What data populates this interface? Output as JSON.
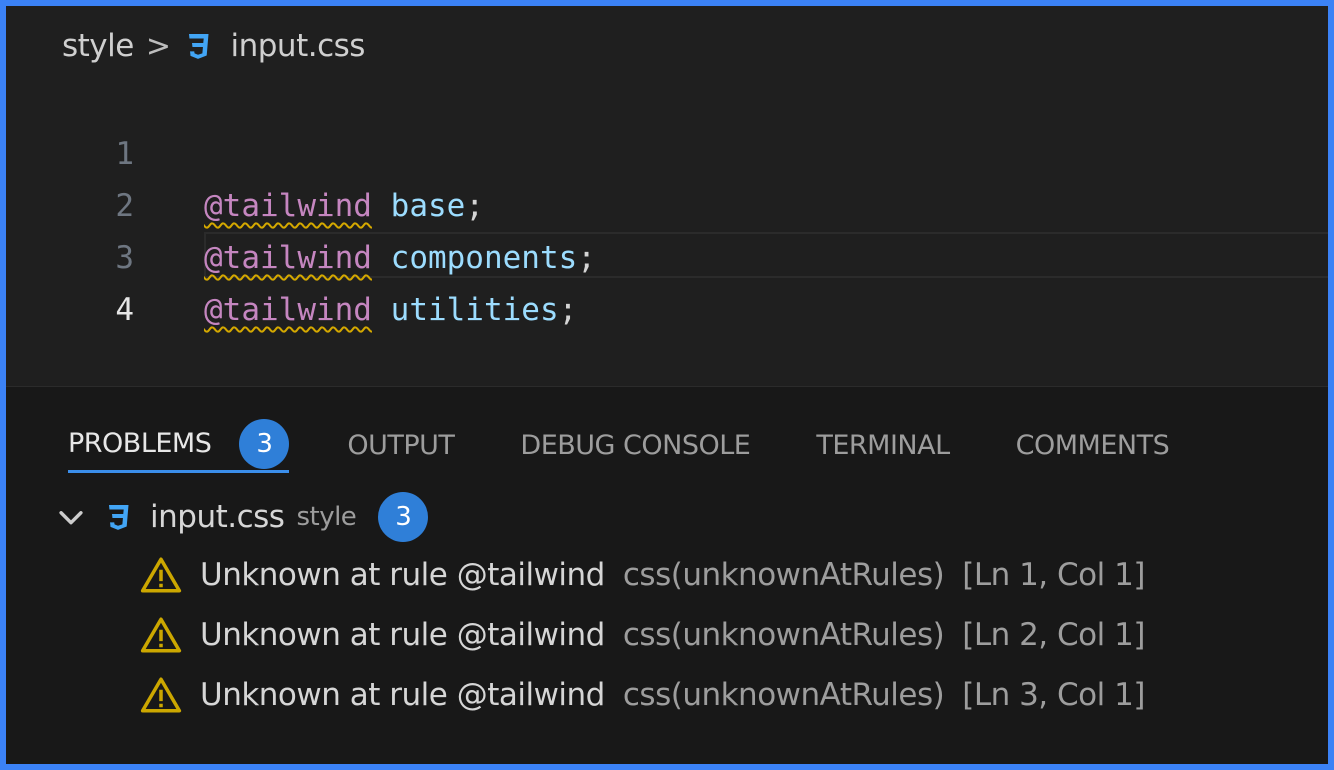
{
  "breadcrumb": {
    "folder": "style",
    "separator": ">",
    "file": "input.css"
  },
  "editor": {
    "lines": [
      {
        "number": "1",
        "keyword": "@tailwind",
        "value": "base",
        "punct": ";"
      },
      {
        "number": "2",
        "keyword": "@tailwind",
        "value": "components",
        "punct": ";"
      },
      {
        "number": "3",
        "keyword": "@tailwind",
        "value": "utilities",
        "punct": ";"
      },
      {
        "number": "4",
        "keyword": "",
        "value": "",
        "punct": ""
      }
    ],
    "active_line": "4"
  },
  "panel": {
    "tabs": [
      {
        "label": "PROBLEMS",
        "badge": "3"
      },
      {
        "label": "OUTPUT"
      },
      {
        "label": "DEBUG CONSOLE"
      },
      {
        "label": "TERMINAL"
      },
      {
        "label": "COMMENTS"
      }
    ],
    "file_group": {
      "file": "input.css",
      "folder": "style",
      "count": "3"
    },
    "problems": [
      {
        "message": "Unknown at rule @tailwind",
        "source": "css(unknownAtRules)",
        "location": "[Ln 1, Col 1]"
      },
      {
        "message": "Unknown at rule @tailwind",
        "source": "css(unknownAtRules)",
        "location": "[Ln 2, Col 1]"
      },
      {
        "message": "Unknown at rule @tailwind",
        "source": "css(unknownAtRules)",
        "location": "[Ln 3, Col 1]"
      }
    ]
  },
  "colors": {
    "frame": "#3b82f6",
    "badge": "#2f7fd8",
    "keyword": "#c586c0",
    "identifier": "#9cdcfe",
    "warning": "#cca700"
  },
  "icons": {
    "css_file": "css3-icon",
    "warning": "warning-icon",
    "chevron": "chevron-down-icon"
  }
}
